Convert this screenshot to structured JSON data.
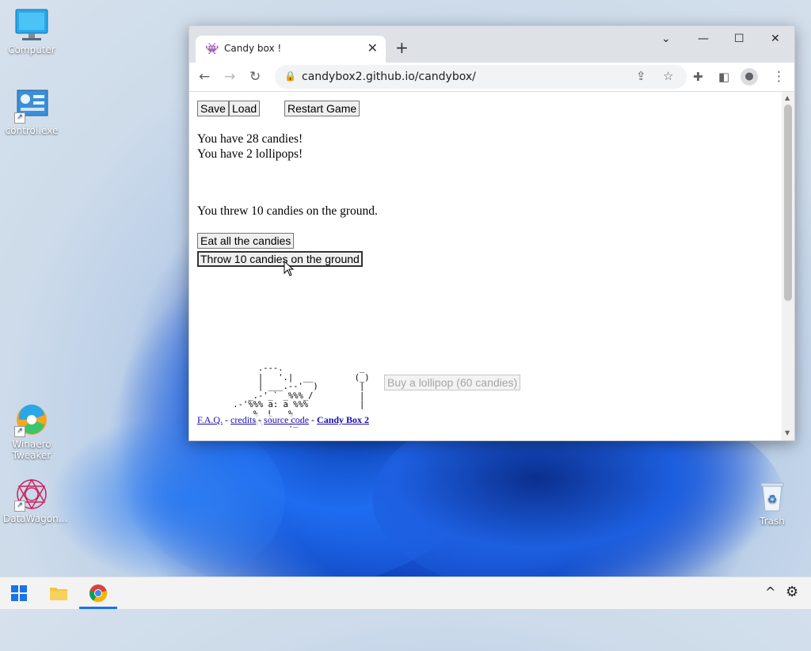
{
  "desktop": {
    "icons": [
      {
        "label": "Computer"
      },
      {
        "label": "control.exe"
      },
      {
        "label": "Winaero Tweaker"
      },
      {
        "label": "DataWagon..."
      },
      {
        "label": "Trash"
      }
    ]
  },
  "browser": {
    "tab_title": "Candy box !",
    "new_tab_symbol": "+",
    "url": "candybox2.github.io/candybox/",
    "window_controls": {
      "minimize": "—",
      "maximize": "☐",
      "close": "✕",
      "tab_list": "⌄"
    }
  },
  "game": {
    "save_label": "Save",
    "load_label": "Load",
    "restart_label": "Restart Game",
    "candies_text": "You have 28 candies!",
    "lollipops_text": "You have 2 lollipops!",
    "status_text": "You threw 10 candies on the ground.",
    "eat_button": "Eat all the candies",
    "throw_button": "Throw 10 candies on the ground",
    "buy_lollipop_button": "Buy a lollipop (60 candies)",
    "merchant_art": "         .---.\n         |   '.|  __\n         | ___.--'  )\n       _.-'_` _%%%_/\n    .-'%%% a: a %%%\n        %  L   %_\n        %\\ '   |_/",
    "lollipop_art": "   _\n  (_)\n   |\n   |\n   |",
    "footer": {
      "faq": "F.A.Q.",
      "sep1": " - ",
      "credits": "credits",
      "sep2": " - ",
      "source": "source code",
      "sep3": " - ",
      "candybox2": "Candy Box 2"
    }
  },
  "colors": {
    "accent": "#1a73e8",
    "link": "#1a0dab",
    "tab_bar": "#dee1e6"
  }
}
